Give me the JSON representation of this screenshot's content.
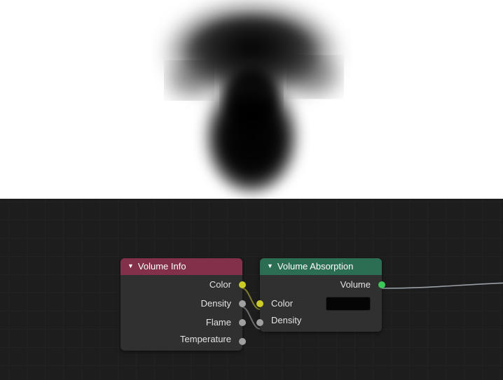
{
  "nodes": {
    "volume_info": {
      "title": "Volume Info",
      "header_color": "#83314a",
      "outputs": [
        {
          "label": "Color",
          "socket_color": "yellow"
        },
        {
          "label": "Density",
          "socket_color": "grey"
        },
        {
          "label": "Flame",
          "socket_color": "grey"
        },
        {
          "label": "Temperature",
          "socket_color": "grey"
        }
      ]
    },
    "volume_absorption": {
      "title": "Volume Absorption",
      "header_color": "#2b6e53",
      "outputs": [
        {
          "label": "Volume",
          "socket_color": "green"
        }
      ],
      "inputs": [
        {
          "label": "Color",
          "socket_color": "yellow",
          "swatch": "#050505"
        },
        {
          "label": "Density",
          "socket_color": "grey"
        }
      ]
    }
  },
  "links": [
    {
      "from": "volume_info.Color",
      "to": "volume_absorption.Color"
    },
    {
      "from": "volume_info.Density",
      "to": "volume_absorption.Density"
    },
    {
      "from": "volume_absorption.Volume",
      "to": "offscreen-right"
    }
  ]
}
